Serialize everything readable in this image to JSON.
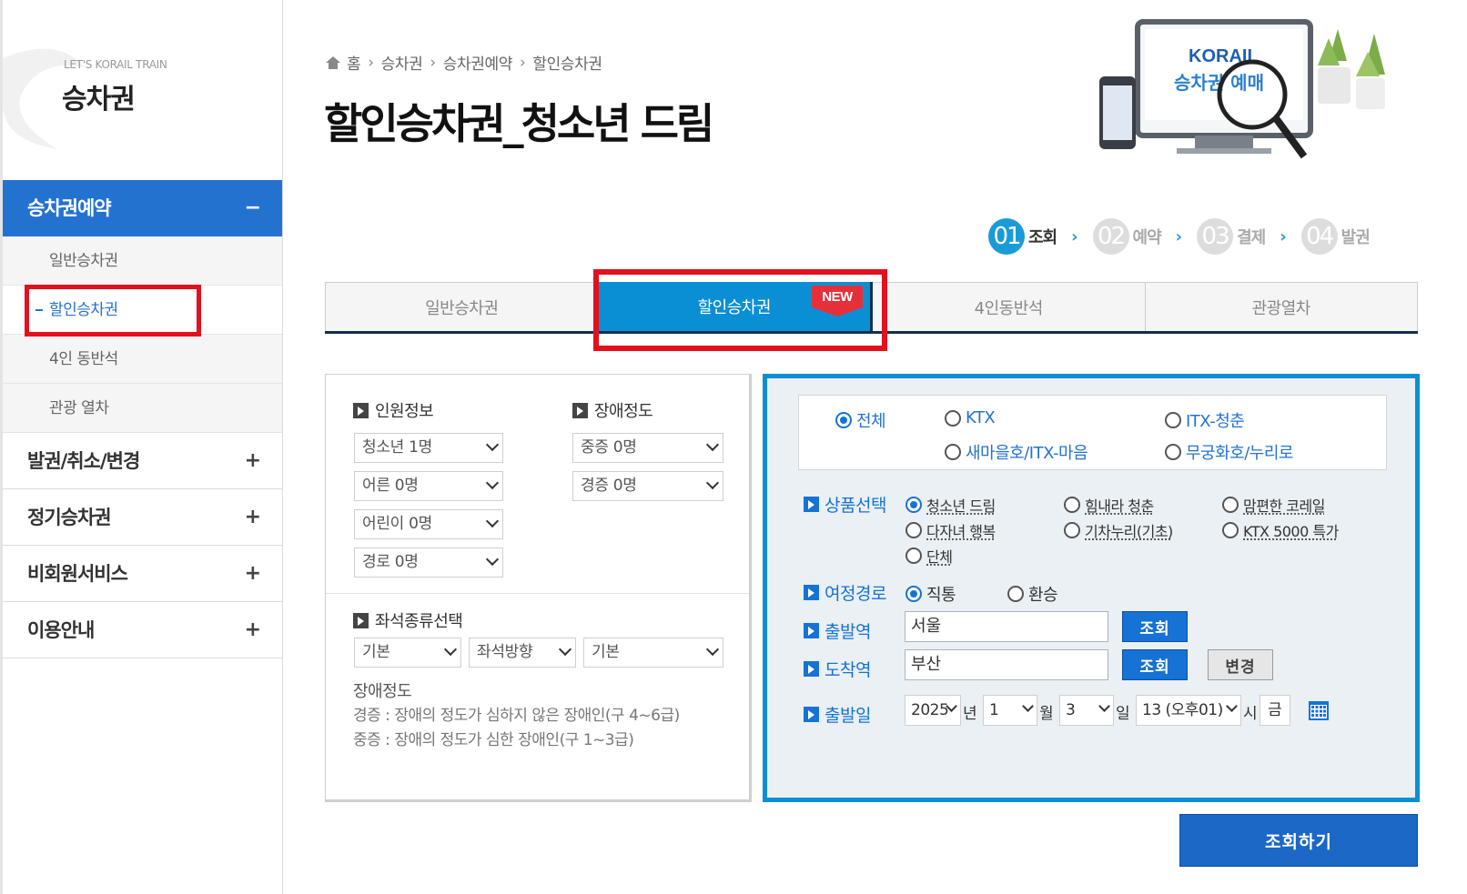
{
  "sidebar": {
    "brand_sub": "LET'S KORAIL TRAIN",
    "brand_title": "승차권",
    "active_menu": {
      "label": "승차권예약",
      "sign": "−"
    },
    "sub_items": [
      {
        "label": "일반승차권"
      },
      {
        "label": "할인승차권"
      },
      {
        "label": "4인 동반석"
      },
      {
        "label": "관광 열차"
      }
    ],
    "menus": [
      {
        "label": "발권/취소/변경",
        "sign": "+"
      },
      {
        "label": "정기승차권",
        "sign": "+"
      },
      {
        "label": "비회원서비스",
        "sign": "+"
      },
      {
        "label": "이용안내",
        "sign": "+"
      }
    ]
  },
  "breadcrumb": [
    "홈",
    "승차권",
    "승차권예약",
    "할인승차권"
  ],
  "page_title": "할인승차권_청소년 드림",
  "banner": {
    "logo": "KORAIL",
    "text": "승차권 예매"
  },
  "steps": [
    {
      "num": "01",
      "label": "조회"
    },
    {
      "num": "02",
      "label": "예약"
    },
    {
      "num": "03",
      "label": "결제"
    },
    {
      "num": "04",
      "label": "발권"
    }
  ],
  "tabs": [
    {
      "label": "일반승차권"
    },
    {
      "label": "할인승차권"
    },
    {
      "label": "4인동반석"
    },
    {
      "label": "관광열차"
    }
  ],
  "new_badge": "NEW",
  "left_panel": {
    "passenger_title": "인원정보",
    "passengers": [
      "청소년 1명",
      "어른 0명",
      "어린이 0명",
      "경로 0명"
    ],
    "disability_title": "장애정도",
    "disability": [
      "중증 0명",
      "경증 0명"
    ],
    "seat_title": "좌석종류선택",
    "seat_options": [
      "기본",
      "좌석방향",
      "기본"
    ],
    "note_title": "장애정도",
    "note_lines": [
      "경증 : 장애의 정도가 심하지 않은 장애인(구 4~6급)",
      "중증 : 장애의 정도가 심한 장애인(구 1~3급)"
    ]
  },
  "right_panel": {
    "train_types": [
      "전체",
      "KTX",
      "ITX-청춘",
      "새마을호/ITX-마음",
      "무궁화호/누리로"
    ],
    "product_label": "상품선택",
    "products": [
      "청소년 드림",
      "힘내라 청춘",
      "맘편한 코레일",
      "다자녀 행복",
      "기차누리(기초)",
      "KTX 5000 특가",
      "단체"
    ],
    "route_label": "여정경로",
    "routes": [
      "직통",
      "환승"
    ],
    "departure_label": "출발역",
    "departure_value": "서울",
    "arrival_label": "도착역",
    "arrival_value": "부산",
    "lookup_label": "조회",
    "change_label": "변경",
    "date_label": "출발일",
    "year": "2025",
    "year_unit": "년",
    "month": "1",
    "month_unit": "월",
    "day": "3",
    "day_unit": "일",
    "hour": "13 (오후01)",
    "hour_unit": "시",
    "weekday": "금"
  },
  "search_button": "조회하기",
  "colors": {
    "accent": "#2472d0",
    "tab_active": "#0a8fd4",
    "highlight": "#e3101d"
  }
}
